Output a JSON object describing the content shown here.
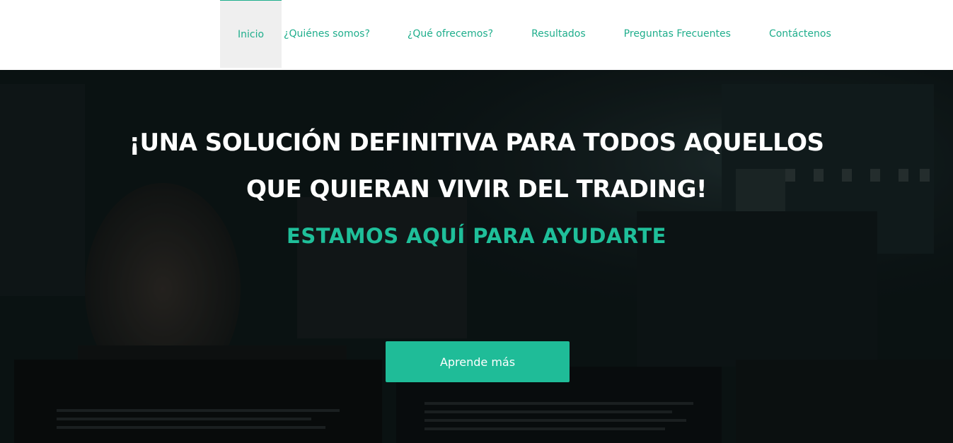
{
  "nav": {
    "items": [
      {
        "label": "Inicio",
        "active": true
      },
      {
        "label": "¿Quiénes somos?"
      },
      {
        "label": "¿Qué ofrecemos?"
      },
      {
        "label": "Resultados"
      },
      {
        "label": "Preguntas Frecuentes"
      },
      {
        "label": "Contáctenos"
      }
    ]
  },
  "hero": {
    "title_line1": "¡UNA SOLUCIÓN DEFINITIVA PARA TODOS AQUELLOS",
    "title_line2": "QUE QUIERAN VIVIR DEL TRADING!",
    "subtitle": "ESTAMOS AQUÍ PARA AYUDARTE",
    "button_label": "Aprende más"
  },
  "colors": {
    "accent": "#1fbc98",
    "nav_text": "#1fae8c",
    "active_bg": "#efefef",
    "hero_dark": "#101c1d"
  }
}
